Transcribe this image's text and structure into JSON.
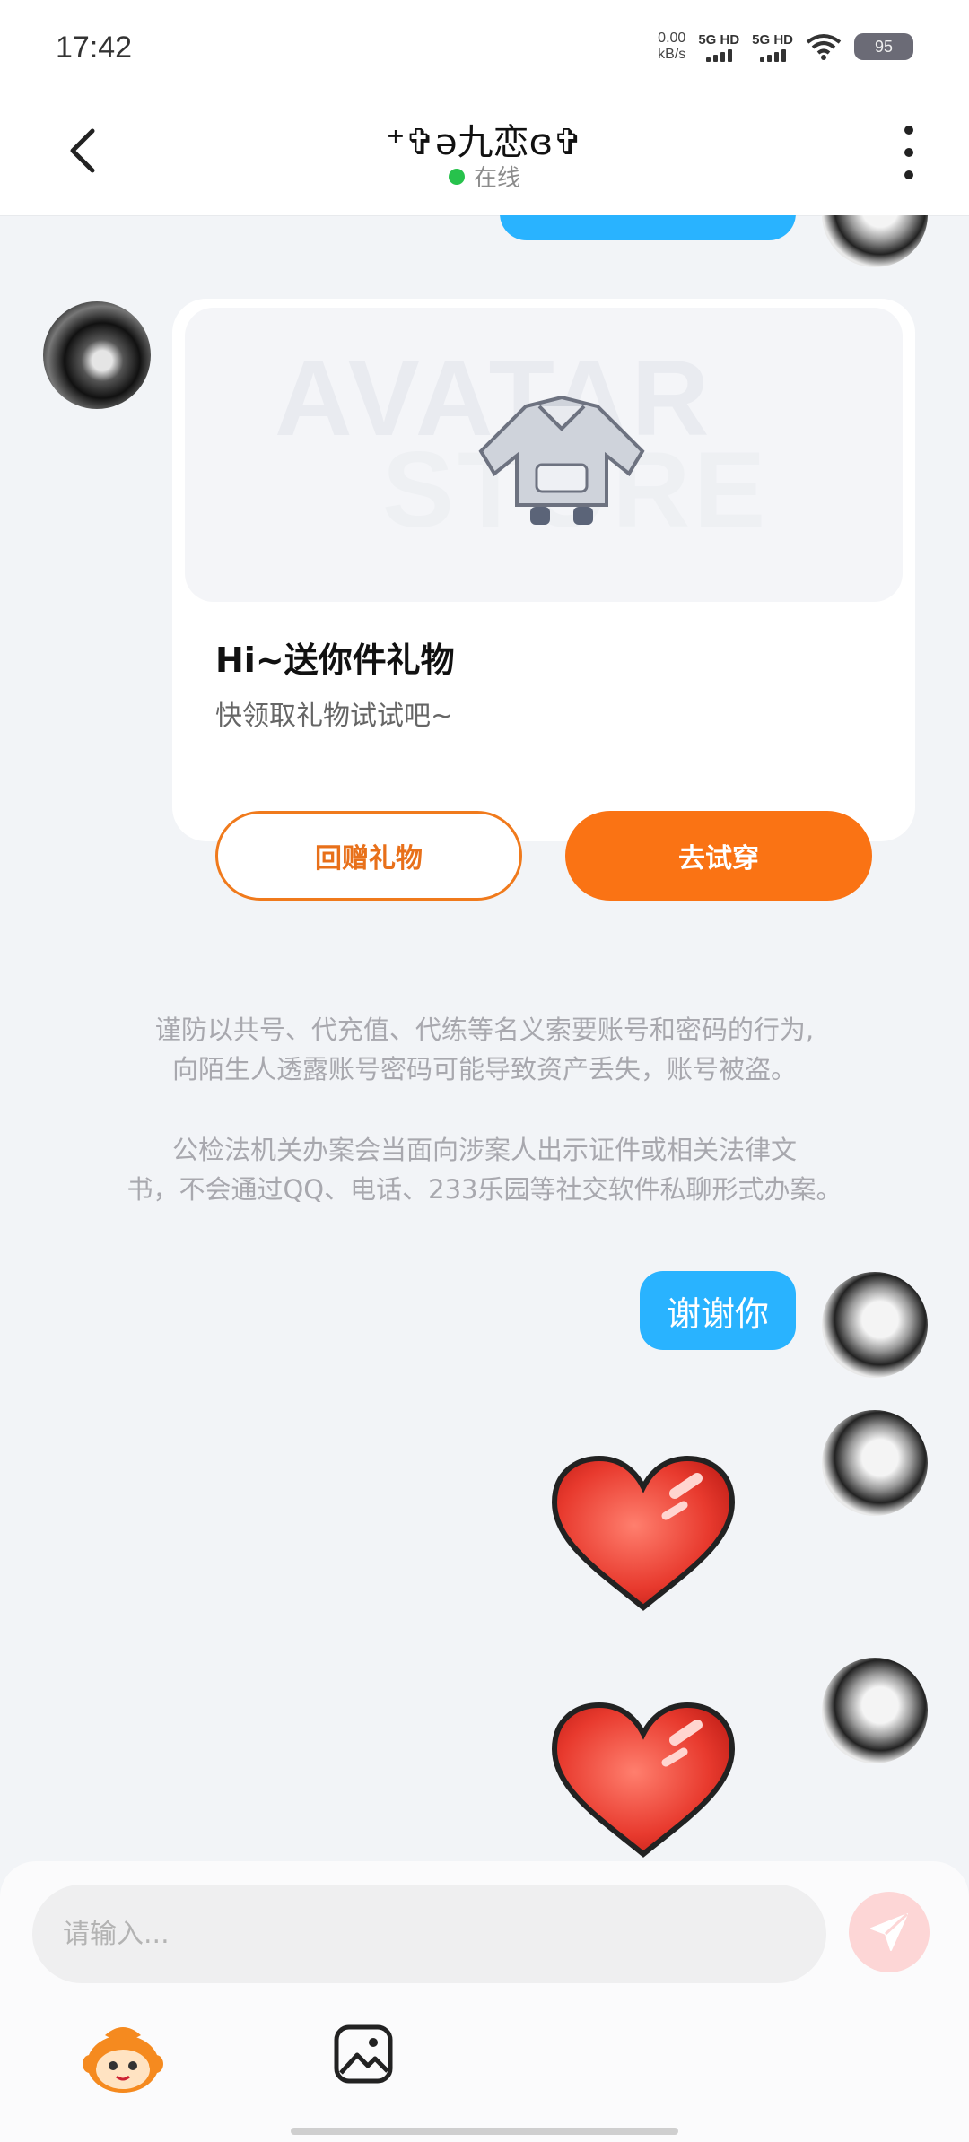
{
  "status_bar": {
    "time": "17:42",
    "net_speed_value": "0.00",
    "net_speed_unit": "kB/s",
    "sim1": "5G HD",
    "sim2": "5G HD",
    "battery": "95"
  },
  "header": {
    "title": "⁺✞ə九恋ɞ✞",
    "status": "在线",
    "status_color": "#27c24c",
    "back_icon": "chevron-left-icon",
    "more_icon": "vertical-dots-icon"
  },
  "gift_card": {
    "image_text_line1": "AVATAR",
    "image_text_line2": "STORE",
    "title": "Hi~送你件礼物",
    "subtitle": "快领取礼物试试吧~",
    "return_button": "回赠礼物",
    "try_button": "去试穿",
    "accent_color": "#fa7314"
  },
  "notices": {
    "account_warning_line1": "谨防以共号、代充值、代练等名义索要账号和密码的行为,",
    "account_warning_line2": "向陌生人透露账号密码可能导致资产丢失，账号被盗。",
    "police_notice_line1": "公检法机关办案会当面向涉案人出示证件或相关法律文",
    "police_notice_line2": "书，不会通过QQ、电话、233乐园等社交软件私聊形式办案。"
  },
  "messages": [
    {
      "sender": "me",
      "type": "text",
      "text": "谢谢你",
      "bubble_color": "#29b3ff"
    },
    {
      "sender": "me",
      "type": "sticker",
      "sticker": "heart-icon"
    },
    {
      "sender": "me",
      "type": "sticker",
      "sticker": "heart-icon"
    }
  ],
  "composer": {
    "placeholder": "请输入...",
    "send_icon": "paper-plane-icon",
    "emoji_icon": "mascot-emoji-icon",
    "image_icon": "image-icon"
  }
}
